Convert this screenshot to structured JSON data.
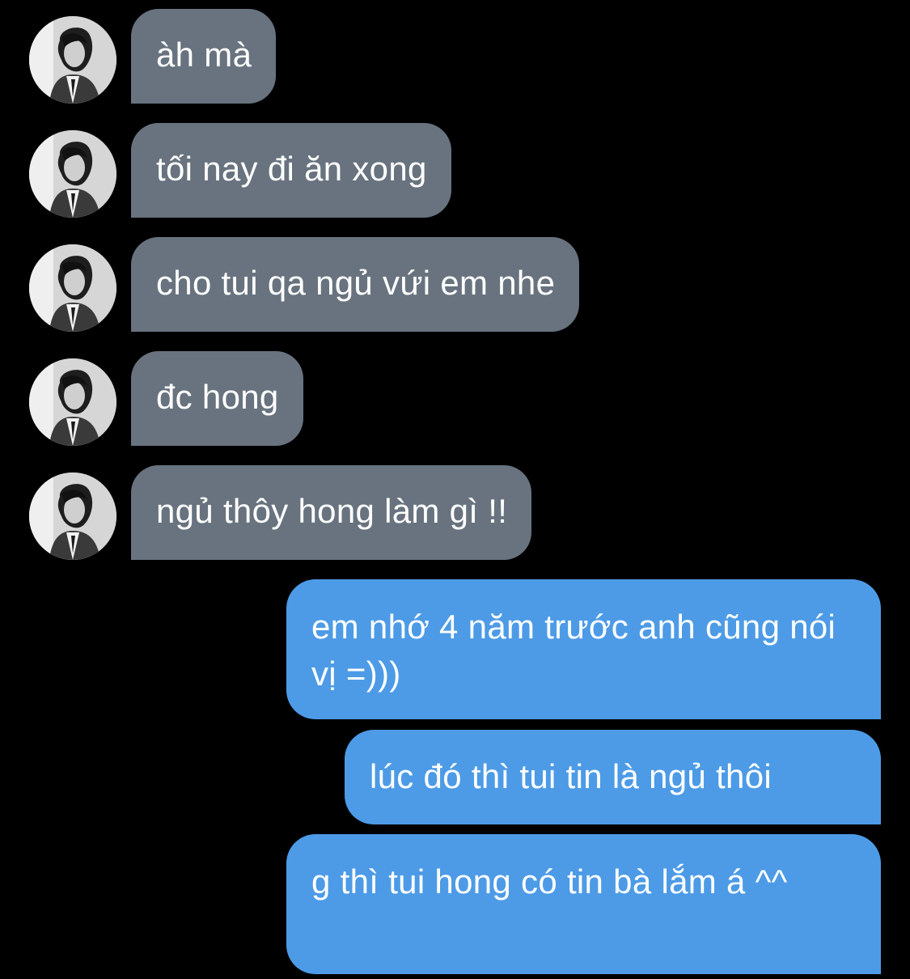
{
  "conversation": {
    "incoming": [
      {
        "text": "àh mà",
        "avatar_icon": "profile-photo-grayscale-person"
      },
      {
        "text": "tối nay đi ăn xong",
        "avatar_icon": "profile-photo-grayscale-person"
      },
      {
        "text": "cho tui qa ngủ vứi em nhe",
        "avatar_icon": "profile-photo-grayscale-person"
      },
      {
        "text": "đc hong",
        "avatar_icon": "profile-photo-grayscale-person"
      },
      {
        "text": "ngủ thôy hong làm gì !!",
        "avatar_icon": "profile-photo-grayscale-person"
      }
    ],
    "outgoing": [
      {
        "text": "em nhớ 4 năm trước anh cũng nói vị =)))"
      },
      {
        "text": "lúc đó thì tui tin là ngủ thôi"
      },
      {
        "text": "g thì tui hong có tin bà lắm á ^^"
      }
    ]
  },
  "colors": {
    "background": "#000000",
    "incoming_bubble": "#68737f",
    "outgoing_bubble": "#4d9be6",
    "text": "#ffffff"
  }
}
